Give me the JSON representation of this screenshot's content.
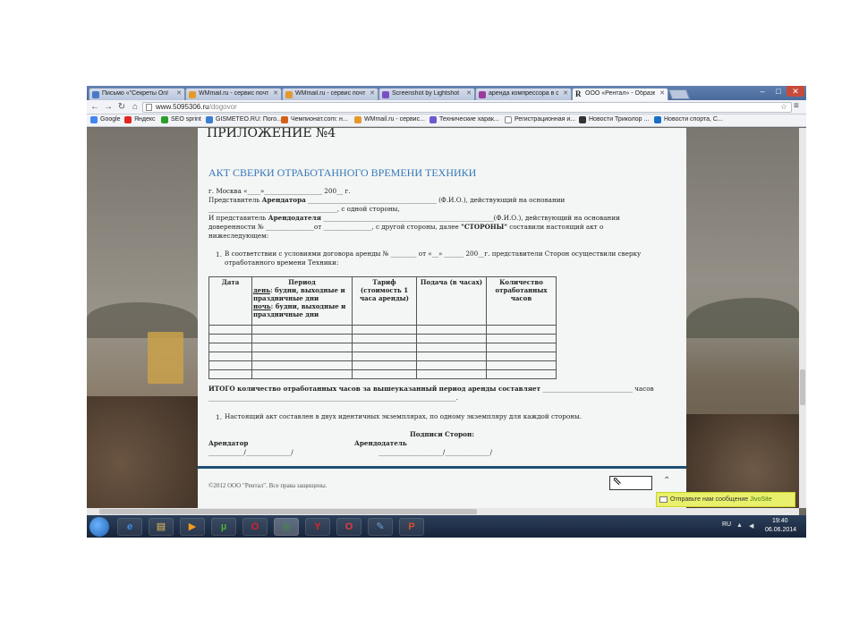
{
  "browser": {
    "tabs": [
      {
        "title": "Письмо «\"Секреты Onl",
        "icon_color": "#4a78c8"
      },
      {
        "title": "WMmail.ru - сервис почт",
        "icon_color": "#e49a2a"
      },
      {
        "title": "WMmail.ru - сервис почт",
        "icon_color": "#e49a2a"
      },
      {
        "title": "Screenshot by Lightshot",
        "icon_color": "#7a4fc4"
      },
      {
        "title": "аренда компрессора в с",
        "icon_color": "#9b3c9b"
      },
      {
        "title": "ООО «Рентал» - Образец",
        "icon_glyph": "R",
        "active": true
      }
    ],
    "window_controls": {
      "minimize": "–",
      "maximize": "□",
      "close": "✕"
    },
    "url_host": "www.5095306.ru",
    "url_path": "/dogovor",
    "bookmarks": [
      {
        "label": "Google",
        "icon_color": "#4285f4"
      },
      {
        "label": "Яндекс",
        "icon_color": "#e52620"
      },
      {
        "label": "SEO sprint",
        "icon_color": "#2aa02a"
      },
      {
        "label": "GISMETEO.RU: Пого...",
        "icon_color": "#3a7fd0"
      },
      {
        "label": "Чемпионат.com: н...",
        "icon_color": "#d4601a"
      },
      {
        "label": "WMmail.ru - сервис...",
        "icon_color": "#e49a2a"
      },
      {
        "label": "Технические харак...",
        "icon_color": "#6d5ad1"
      },
      {
        "label": "Регистрационная и...",
        "icon_color": "#888888"
      },
      {
        "label": "Новости Триколор ...",
        "icon_color": "#333333"
      },
      {
        "label": "Новости спорта, С...",
        "icon_color": "#1a6fc4"
      }
    ]
  },
  "document": {
    "heading": "ПРИЛОЖЕНИЕ №4",
    "title": "АКТ СВЕРКИ ОТРАБОТАННОГО ВРЕМЕНИ ТЕХНИКИ",
    "city_line": "г.  Москва                                        «____»__________________ 200__ г.",
    "rep_prefix": "Представитель ",
    "rep_bold": "Арендатора",
    "rep_suffix": " ________________________________________ (Ф.И.О.), действующий на основании",
    "side1_line": "________________________________________, с одной стороны,",
    "rep2_prefix": "И представитель ",
    "rep2_bold": "Арендодателя",
    "rep2_suffix": " _____________________________________________________(Ф.И.О.), действующий на основании",
    "power_prefix": "доверенности № _______________от _______________, с другой стороны, далее ",
    "power_bold": "\"СТОРОНЫ\"",
    "power_suffix": " составили настоящий акт о",
    "below_line": "нижеследующем:",
    "item1_num": "1.",
    "item1_line1": "В соответствии с условиями договора аренды № ________ от «__» ______ 200__г. представители Сторон осуществили сверку",
    "item1_line2": "отработанного времени Техники:",
    "table": {
      "col_date": "Дата",
      "col_period_title": "Период",
      "col_period_day_u": "день",
      "col_period_day": ": будни, выходные и праздничные дни",
      "col_period_night_u": "ночь",
      "col_period_night": ": будни, выходные и праздничные дни",
      "col_tariff": "Тариф (стоимость 1 часа аренды)",
      "col_supply": "Подача (в часах)",
      "col_count": "Количество отработанных часов"
    },
    "total_bold": "ИТОГО количество отработанных часов за вышеуказанный период аренды составляет",
    "total_suffix": " ____________________________ часов",
    "total_line2": "_____________________________________________________________________________.",
    "item2_num": "1.",
    "item2_text": "Настоящий акт составлен в двух идентичных экземплярах, по одному экземпляру для каждой стороны.",
    "signatures_title": "Подписи Сторон:",
    "tenant_label": "Арендатор",
    "landlord_label": "Арендодатель",
    "tenant_sign": "___________/______________/",
    "landlord_sign": "____________________/______________/",
    "copyright": "©2012 ООО \"Рентал\". Все права защищены."
  },
  "jivo": {
    "text": "Отправьте нам сообщение",
    "brand": "JivoSite"
  },
  "taskbar": {
    "apps": [
      {
        "name": "ie-icon",
        "glyph": "e",
        "color": "#3a8ee6"
      },
      {
        "name": "explorer-icon",
        "glyph": "▤",
        "color": "#e8c15a"
      },
      {
        "name": "media-player-icon",
        "glyph": "▶",
        "color": "#f39c1a"
      },
      {
        "name": "utorrent-icon",
        "glyph": "µ",
        "color": "#4cae3c"
      },
      {
        "name": "opera-icon",
        "glyph": "O",
        "color": "#d8202a"
      },
      {
        "name": "chrome-icon",
        "glyph": "◎",
        "color": "#3b9a3b",
        "active": true
      },
      {
        "name": "yandex-browser-icon",
        "glyph": "Y",
        "color": "#e0261f"
      },
      {
        "name": "opera-next-icon",
        "glyph": "O",
        "color": "#e83a3a"
      },
      {
        "name": "notepad-icon",
        "glyph": "✎",
        "color": "#6aa3d9"
      },
      {
        "name": "powerpoint-icon",
        "glyph": "P",
        "color": "#d8502a"
      }
    ],
    "lang": "RU",
    "time": "19:40",
    "date": "06.06.2014"
  }
}
